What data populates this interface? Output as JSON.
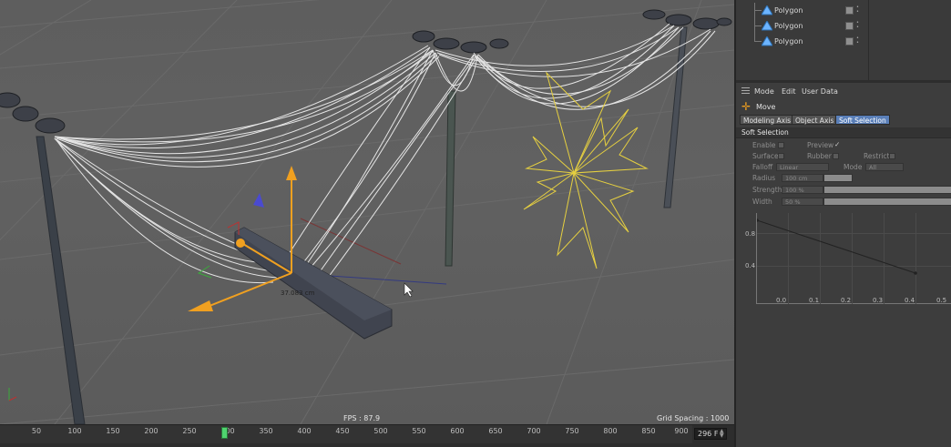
{
  "viewport": {
    "fps_label": "FPS : 87.9",
    "grid_spacing_label": "Grid Spacing : 1000 cm",
    "distance_label": "37.083 cm"
  },
  "timeline": {
    "ticks": [
      "50",
      "100",
      "150",
      "200",
      "250",
      "300",
      "350",
      "400",
      "450",
      "500",
      "550",
      "600",
      "650",
      "700",
      "750",
      "800",
      "850",
      "900"
    ],
    "current_frame": "296 F"
  },
  "object_manager": {
    "items": [
      {
        "name": "Polygon",
        "icon": "polygon-icon"
      },
      {
        "name": "Polygon",
        "icon": "polygon-icon"
      },
      {
        "name": "Polygon",
        "icon": "polygon-icon"
      }
    ]
  },
  "attributes": {
    "menu": [
      "Mode",
      "Edit",
      "User Data"
    ],
    "tool_name": "Move",
    "tabs": [
      "Modeling Axis",
      "Object Axis",
      "Soft Selection"
    ],
    "active_tab": "Soft Selection",
    "section_title": "Soft Selection",
    "props": {
      "enable": "Enable",
      "preview": "Preview",
      "preview_check": "✓",
      "surface": "Surface",
      "rubber": "Rubber",
      "restrict": "Restrict",
      "falloff": "Falloff",
      "falloff_value": "Linear",
      "mode": "Mode",
      "mode_value": "All",
      "radius": "Radius",
      "radius_value": "100 cm",
      "strength": "Strength",
      "strength_value": "100 %",
      "width": "Width",
      "width_value": "50 %"
    },
    "graph": {
      "y_labels": [
        "0.8",
        "0.4"
      ],
      "x_labels": [
        "0.0",
        "0.1",
        "0.2",
        "0.3",
        "0.4",
        "0.5"
      ]
    }
  },
  "colors": {
    "accent_tab": "#5a7fb8",
    "playhead": "#4fd46f",
    "move_icon": "#f0a020"
  }
}
